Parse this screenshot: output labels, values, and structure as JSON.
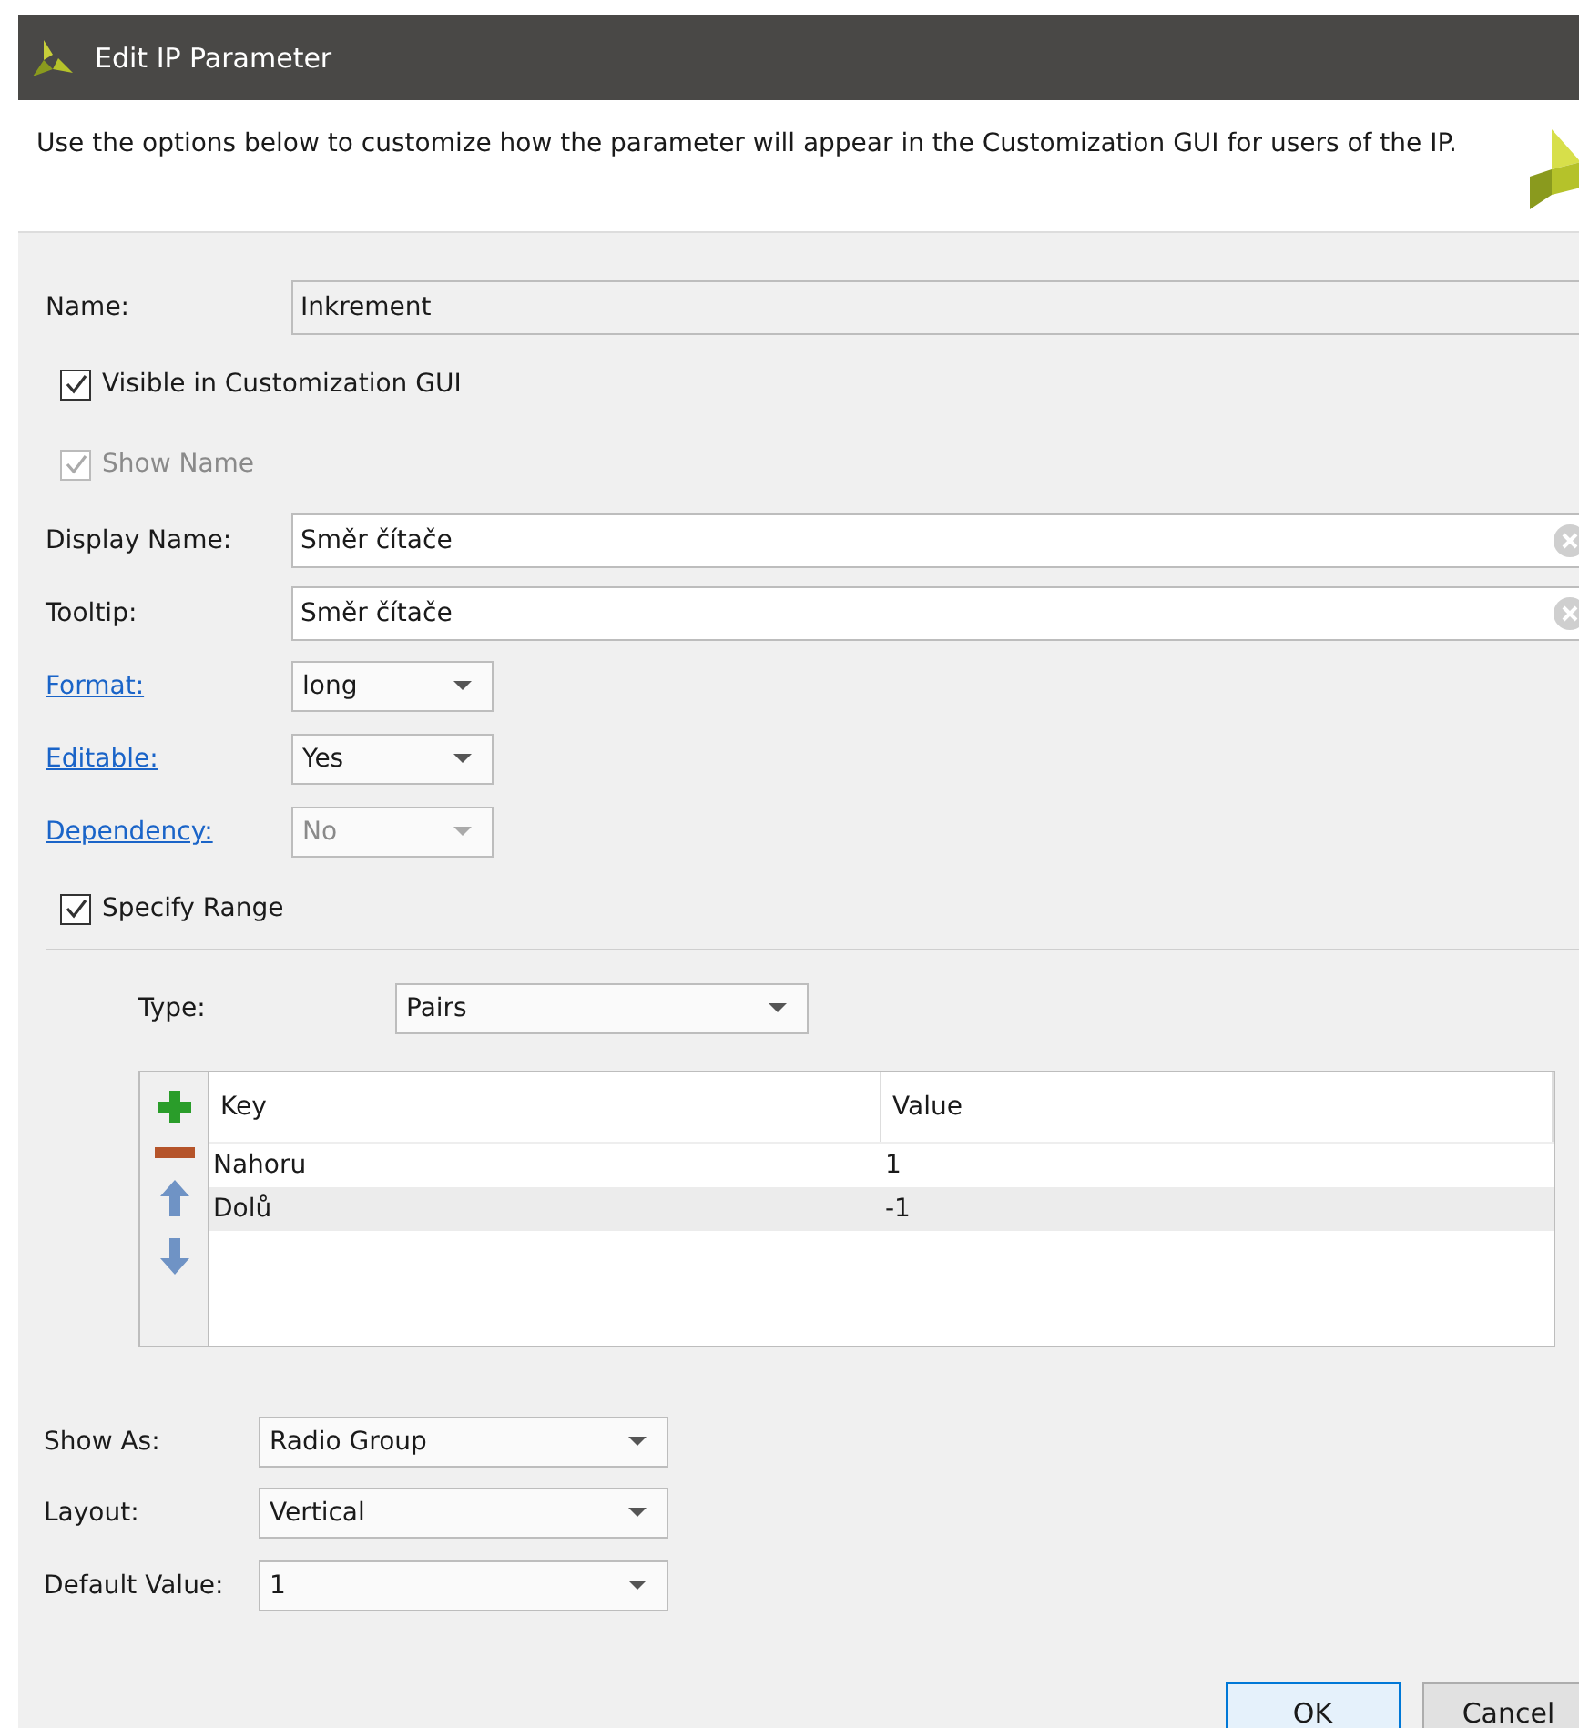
{
  "window": {
    "title": "Edit IP Parameter"
  },
  "description": "Use the options below to customize how the parameter will appear in the Customization GUI for users of the IP.",
  "form": [
    {
      "kind": "text",
      "label": "Name:",
      "value": "Inkrement",
      "read_only": true
    },
    {
      "kind": "checkbox",
      "label": "Visible in Customization GUI",
      "checked": true,
      "disabled": false
    },
    {
      "kind": "checkbox",
      "label": "Show Name",
      "checked": true,
      "disabled": true
    },
    {
      "kind": "text",
      "label": "Display Name:",
      "value": "Směr čítače",
      "read_only": false
    },
    {
      "kind": "text",
      "label": "Tooltip:",
      "value": "Směr čítače",
      "read_only": false
    },
    {
      "kind": "dropdown",
      "label": "Format:",
      "value": "long",
      "disabled": false
    },
    {
      "kind": "dropdown",
      "label": "Editable:",
      "value": "Yes",
      "disabled": false
    },
    {
      "kind": "dropdown",
      "label": "Dependency:",
      "value": "No",
      "disabled": true
    },
    {
      "kind": "checkbox",
      "label": "Specify Range",
      "checked": true,
      "disabled": false
    }
  ],
  "range": {
    "type_label": "Type:",
    "type_value": "Pairs",
    "columns": [
      "Key",
      "Value"
    ],
    "rows": [
      {
        "cells": [
          "Nahoru",
          "1"
        ],
        "selected": false
      },
      {
        "cells": [
          "Dolů",
          "-1"
        ],
        "selected": true
      }
    ]
  },
  "display": [
    {
      "label": "Show As:",
      "value": "Radio Group"
    },
    {
      "label": "Layout:",
      "value": "Vertical"
    },
    {
      "label": "Default Value:",
      "value": "1"
    }
  ],
  "buttons": [
    {
      "label": "OK",
      "kind": "default"
    },
    {
      "label": "Cancel",
      "kind": "normal"
    }
  ]
}
